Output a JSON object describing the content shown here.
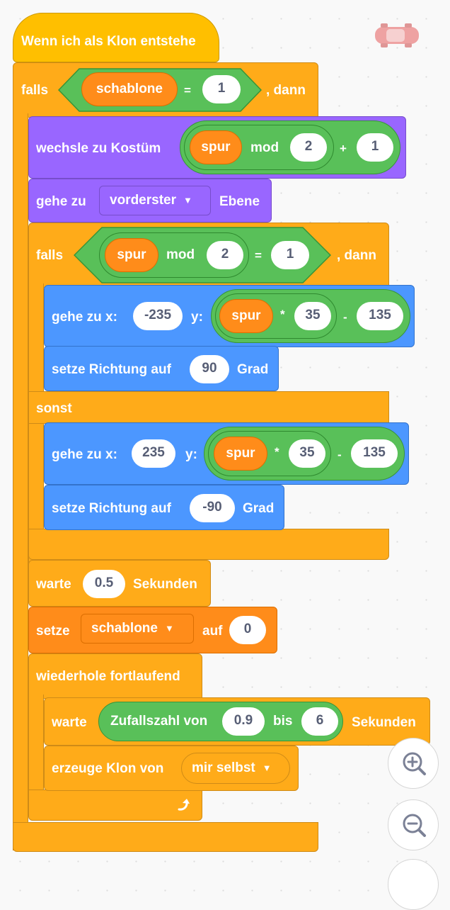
{
  "hat": {
    "label": "Wenn ich als Klon entstehe"
  },
  "if1": {
    "falls": "falls",
    "dann": ", dann",
    "var": "schablone",
    "eq": "=",
    "value": "1"
  },
  "costume": {
    "label": "wechsle zu Kostüm",
    "var": "spur",
    "mod": "mod",
    "mod_value": "2",
    "plus": "+",
    "add_value": "1"
  },
  "layer": {
    "label": "gehe zu",
    "dropdown": "vorderster",
    "suffix": "Ebene"
  },
  "if2": {
    "falls": "falls",
    "dann": ", dann",
    "var": "spur",
    "mod": "mod",
    "mod_value": "2",
    "eq": "=",
    "value": "1",
    "sonst": "sonst"
  },
  "goto1": {
    "label": "gehe zu x:",
    "x": "-235",
    "y_label": "y:",
    "var": "spur",
    "times": "*",
    "mult": "35",
    "minus": "-",
    "sub": "135"
  },
  "dir1": {
    "label": "setze Richtung auf",
    "value": "90",
    "suffix": "Grad"
  },
  "goto2": {
    "label": "gehe zu x:",
    "x": "235",
    "y_label": "y:",
    "var": "spur",
    "times": "*",
    "mult": "35",
    "minus": "-",
    "sub": "135"
  },
  "dir2": {
    "label": "setze Richtung auf",
    "value": "-90",
    "suffix": "Grad"
  },
  "wait1": {
    "label": "warte",
    "value": "0.5",
    "suffix": "Sekunden"
  },
  "setvar": {
    "label": "setze",
    "dropdown": "schablone",
    "auf": "auf",
    "value": "0"
  },
  "forever": {
    "label": "wiederhole fortlaufend"
  },
  "wait2": {
    "label": "warte",
    "op_label": "Zufallszahl von",
    "from": "0.9",
    "bis": "bis",
    "to": "6",
    "suffix": "Sekunden"
  },
  "clone": {
    "label": "erzeuge Klon von",
    "dropdown": "mir selbst"
  },
  "icons": {
    "sprite": "car-sprite-icon",
    "loop": "loop-arrow-icon",
    "zoom_in": "zoom-in-icon",
    "zoom_out": "zoom-out-icon"
  }
}
